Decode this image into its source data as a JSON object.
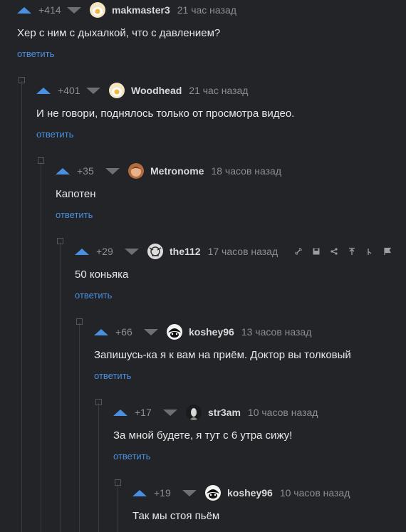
{
  "comments": [
    {
      "rating": "+414",
      "username": "makmaster3",
      "time": "21 час назад",
      "text": "Хер с ним с дыхалкой, что с давлением?",
      "reply": "ответить",
      "avatar": "avatar-egg-icon"
    },
    {
      "rating": "+401",
      "username": "Woodhead",
      "time": "21 час назад",
      "text": "И не говори, поднялось только от просмотра видео.",
      "reply": "ответить",
      "avatar": "avatar-egg-icon"
    },
    {
      "rating": "+35",
      "username": "Metronome",
      "time": "18 часов назад",
      "text": "Капотен",
      "reply": "ответить",
      "avatar": "avatar-face-icon"
    },
    {
      "rating": "+29",
      "username": "the112",
      "time": "17 часов назад",
      "text": "50 коньяка",
      "reply": "ответить",
      "avatar": "avatar-sketch-icon"
    },
    {
      "rating": "+66",
      "username": "koshey96",
      "time": "13 часов назад",
      "text": "Запишусь-ка я к вам на приём. Доктор вы толковый",
      "reply": "ответить",
      "avatar": "avatar-mask-icon"
    },
    {
      "rating": "+17",
      "username": "str3am",
      "time": "10 часов назад",
      "text": "За мной будете, я тут с 6 утра сижу!",
      "reply": "ответить",
      "avatar": "avatar-portrait-icon"
    },
    {
      "rating": "+19",
      "username": "koshey96",
      "time": "10 часов назад",
      "text": "Так мы стоя пьём",
      "reply": "",
      "avatar": "avatar-mask-icon"
    }
  ],
  "toolbar_icons": [
    "link-icon",
    "save-icon",
    "share-icon",
    "upload-icon",
    "pin-icon",
    "flag-icon"
  ],
  "colors": {
    "background": "#232427",
    "accent": "#4a8fe0",
    "vote_up": "#4a90e2",
    "muted": "#8e8e93"
  }
}
